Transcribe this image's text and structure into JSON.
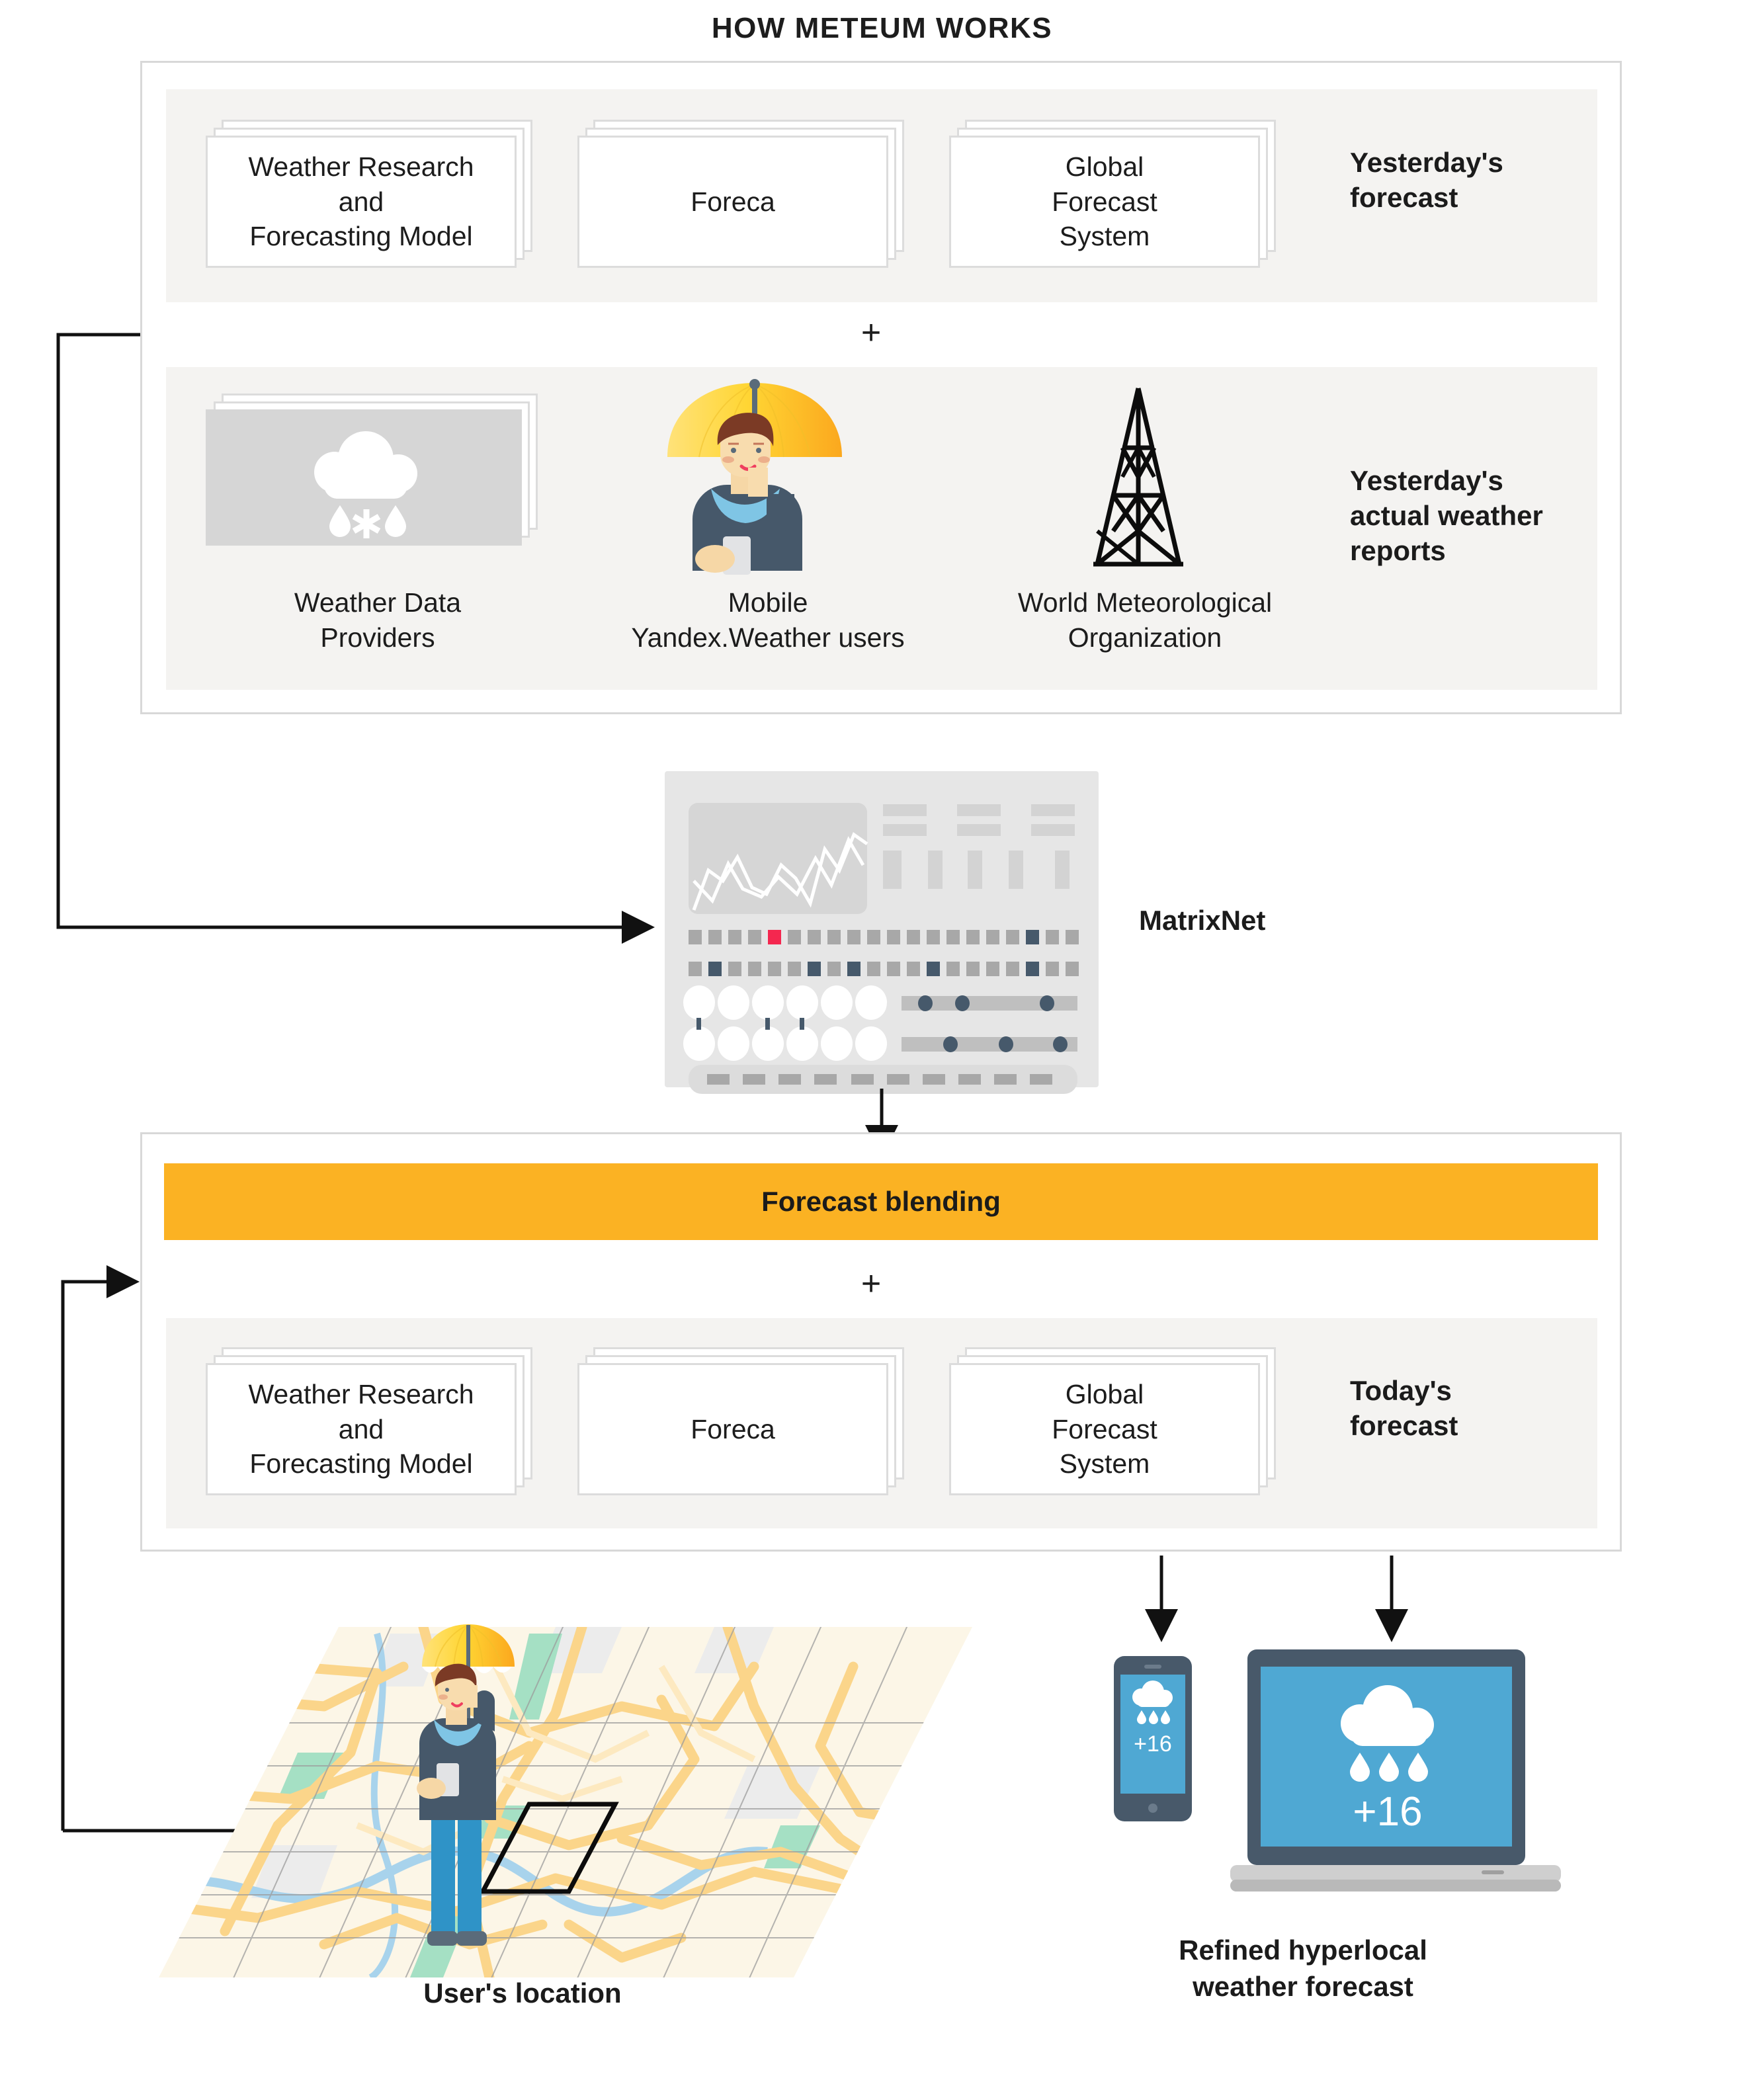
{
  "title": "HOW METEUM WORKS",
  "panels": {
    "top": {
      "row_forecast": {
        "label": "Yesterday's\nforecast",
        "label_lines": [
          "Yesterday's",
          "forecast"
        ],
        "cards": [
          {
            "name": "weather-research-and-forecasting-model",
            "lines": [
              "Weather Research",
              "and",
              "Forecasting Model"
            ]
          },
          {
            "name": "foreca",
            "lines": [
              "Foreca"
            ]
          },
          {
            "name": "global-forecast-system",
            "lines": [
              "Global",
              "Forecast",
              "System"
            ]
          }
        ]
      },
      "separator": "+",
      "row_actual": {
        "label_lines": [
          "Yesterday's",
          "actual weather",
          "reports"
        ],
        "items": [
          {
            "name": "weather-data-providers",
            "icon": "rain-snow-cloud-icon",
            "caption_lines": [
              "Weather Data",
              "Providers"
            ]
          },
          {
            "name": "mobile-yandex-weather-users",
            "icon": "person-with-umbrella-icon",
            "caption_lines": [
              "Mobile",
              "Yandex.Weather users"
            ]
          },
          {
            "name": "world-meteorological-organization",
            "icon": "weather-tower-icon",
            "caption_lines": [
              "World Meteorological",
              "Organization"
            ]
          }
        ]
      }
    },
    "matrixnet": {
      "label": "MatrixNet"
    },
    "bottom": {
      "blending_bar": "Forecast blending",
      "separator": "+",
      "row_today": {
        "label_lines": [
          "Today's",
          "forecast"
        ],
        "cards": [
          {
            "name": "weather-research-and-forecasting-model",
            "lines": [
              "Weather Research",
              "and",
              "Forecasting Model"
            ]
          },
          {
            "name": "foreca",
            "lines": [
              "Foreca"
            ]
          },
          {
            "name": "global-forecast-system",
            "lines": [
              "Global",
              "Forecast",
              "System"
            ]
          }
        ]
      }
    }
  },
  "outputs": {
    "map_caption": "User's location",
    "devices_caption_lines": [
      "Refined hyperlocal",
      "weather forecast"
    ],
    "phone_temperature": "+16",
    "laptop_temperature": "+16"
  },
  "colors": {
    "accent_amber": "#fbb223",
    "panel_border": "#d8d8d8",
    "band_bg": "#f4f3f1",
    "card_border": "#dcdcdc",
    "gray_card": "#d6d6d6",
    "matrixnet_bg": "#e6e6e6",
    "matrixnet_highlight_red": "#f4274f",
    "matrixnet_highlight_navy": "#46596b",
    "device_screen_blue": "#4fa8d3",
    "device_body": "#48596a",
    "umbrella_yellow": "#ffd02e",
    "map_paper": "#fcf6e7",
    "map_road": "#fbd58a",
    "map_water": "#a8d3ec",
    "map_park": "#a5e0c4"
  },
  "chart_data": {
    "type": "table",
    "title": "MatrixNet machine-learning panel (decorative)",
    "grid_row1_highlight_index": 4,
    "grid_row1_highlight_color": "#f4274f",
    "grid_row1_navy_index": 17,
    "grid_row2_navy_indices": [
      1,
      6,
      8,
      12,
      17
    ],
    "grid_columns": 20,
    "node_rows": 2,
    "nodes_per_row": 6,
    "slider_bars": 2,
    "slider_dots": [
      3,
      3
    ]
  }
}
